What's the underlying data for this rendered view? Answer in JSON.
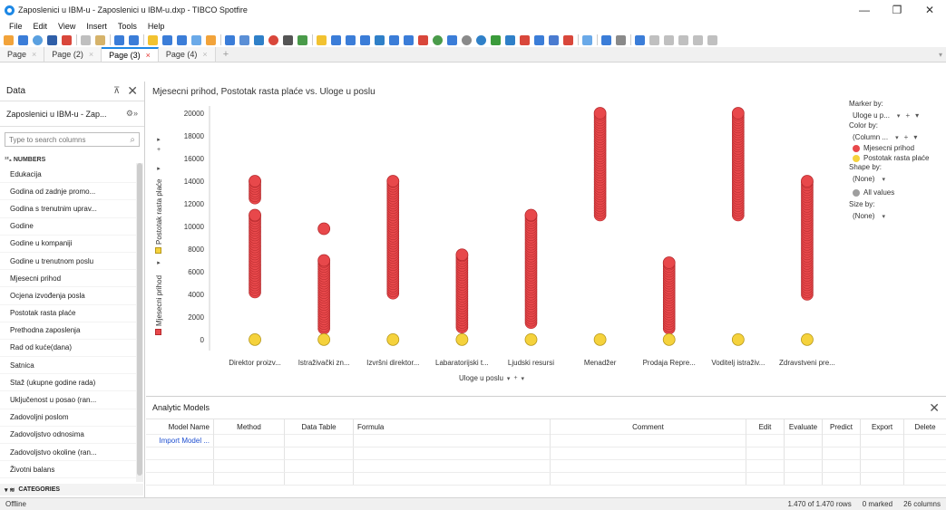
{
  "window": {
    "title": "Zaposlenici u IBM-u - Zaposlenici u IBM-u.dxp - TIBCO Spotfire",
    "minimize": "—",
    "maximize": "❐",
    "close": "✕"
  },
  "menu": [
    "File",
    "Edit",
    "View",
    "Insert",
    "Tools",
    "Help"
  ],
  "tabs": [
    {
      "label": "Page",
      "close": "×"
    },
    {
      "label": "Page (2)",
      "close": "×"
    },
    {
      "label": "Page (3)",
      "close": "×"
    },
    {
      "label": "Page (4)",
      "close": "×"
    }
  ],
  "tab_add": "+",
  "data_panel": {
    "title": "Data",
    "pin": "⊼",
    "close": "✕",
    "source": "Zaposlenici u IBM-u - Zap...",
    "source_menu": "⚙»",
    "search_placeholder": "Type to search columns",
    "numbers_header": "¹²₃ NUMBERS",
    "columns": [
      "Edukacija",
      "Godina od zadnje promo...",
      "Godina s trenutnim uprav...",
      "Godine",
      "Godine u kompaniji",
      "Godine u trenutnom poslu",
      "Mjesecni prihod",
      "Ocjena izvođenja posla",
      "Postotak rasta plaće",
      "Prethodna zaposlenja",
      "Rad od kuće(dana)",
      "Satnica",
      "Staž (ukupne godine rada)",
      "Uključenost u posao (ran...",
      "Zadovoljni poslom",
      "Zadovoljstvo odnosima",
      "Zadovoljstvo okoline (ran...",
      "Životni balans"
    ],
    "categories_header": "CATEGORIES"
  },
  "visualization": {
    "title": "Mjesecni prihod, Postotak rasta plaće vs. Uloge u poslu",
    "y_axis_labels": [
      "Postotak rasta plaće",
      "Mjesecni prihod"
    ],
    "x_axis_selector": "Uloge u poslu",
    "legend": {
      "marker_by_label": "Marker by:",
      "marker_by_value": "Uloge u p...",
      "color_by_label": "Color by:",
      "color_by_value": "(Column ...",
      "color_items": [
        "Mjesecni prihod",
        "Postotak rasta plaće"
      ],
      "shape_by_label": "Shape by:",
      "shape_by_value": "(None)",
      "shape_items": [
        "All values"
      ],
      "size_by_label": "Size by:",
      "size_by_value": "(None)"
    },
    "colors": {
      "mjesecni": "#e8484b",
      "mjesecni_stroke": "#b52a2d",
      "postotak": "#f5d23c",
      "postotak_stroke": "#b7981b",
      "all_values": "#9e9e9e"
    }
  },
  "chart_data": {
    "type": "scatter",
    "title": "Mjesecni prihod, Postotak rasta plaće vs. Uloge u poslu",
    "xlabel": "Uloge u poslu",
    "ylabel": "Mjesecni prihod / Postotak rasta plaće",
    "ylim": [
      0,
      20000
    ],
    "y_ticks": [
      0,
      2000,
      4000,
      6000,
      8000,
      10000,
      12000,
      14000,
      16000,
      18000,
      20000
    ],
    "categories": [
      "Direktor proizv...",
      "Istraživački zn...",
      "Izvršni direktor...",
      "Labaratorijski t...",
      "Ljudski resursi",
      "Menadžer",
      "Prodaja Repre...",
      "Voditelj istraživ...",
      "Zdravstveni pre..."
    ],
    "series": [
      {
        "name": "Mjesecni prihod",
        "ranges": [
          [
            [
              4200,
              11000
            ],
            [
              12500,
              14000
            ]
          ],
          [
            [
              1000,
              7000
            ],
            [
              9800,
              9800
            ]
          ],
          [
            [
              4100,
              14000
            ]
          ],
          [
            [
              1100,
              7500
            ]
          ],
          [
            [
              1500,
              11000
            ]
          ],
          [
            [
              11000,
              20000
            ]
          ],
          [
            [
              1000,
              6800
            ]
          ],
          [
            [
              11000,
              20000
            ]
          ],
          [
            [
              4000,
              14000
            ]
          ]
        ]
      },
      {
        "name": "Postotak rasta plaće",
        "values": [
          11,
          11,
          11,
          11,
          11,
          11,
          11,
          11,
          11
        ]
      }
    ]
  },
  "analytic_models": {
    "title": "Analytic Models",
    "close": "✕",
    "columns": [
      "Model Name",
      "Method",
      "Data Table",
      "Formula",
      "Comment",
      "Edit",
      "Evaluate",
      "Predict",
      "Export",
      "Delete"
    ],
    "import_link": "Import Model ..."
  },
  "status": {
    "left": "Offline",
    "rows": "1.470 of 1.470 rows",
    "marked": "0 marked",
    "columns": "26 columns"
  }
}
